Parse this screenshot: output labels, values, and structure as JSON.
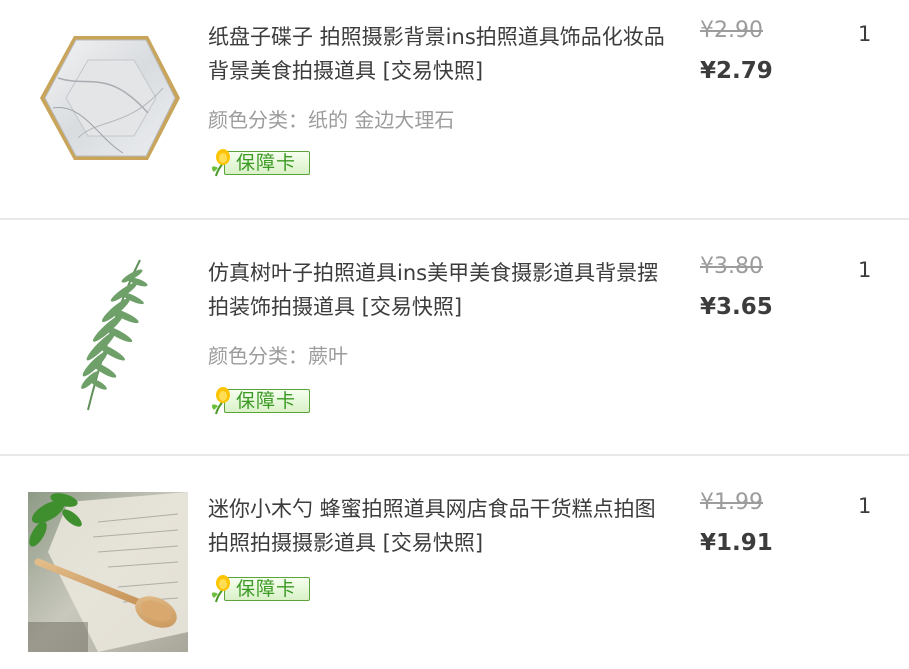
{
  "items": [
    {
      "title": "纸盘子碟子 拍照摄影背景ins拍照道具饰品化妆品背景美食拍摄道具 [交易快照]",
      "sku_label": "颜色分类：",
      "sku_value": "纸的 金边大理石",
      "badge": "保障卡",
      "price_original": "¥2.90",
      "price_current": "¥2.79",
      "quantity": "1",
      "thumb_icon": "hexagon-marble-plate"
    },
    {
      "title": "仿真树叶子拍照道具ins美甲美食摄影道具背景摆拍装饰拍摄道具 [交易快照]",
      "sku_label": "颜色分类：",
      "sku_value": "蕨叶",
      "badge": "保障卡",
      "price_original": "¥3.80",
      "price_current": "¥3.65",
      "quantity": "1",
      "thumb_icon": "fern-leaf"
    },
    {
      "title": "迷你小木勺 蜂蜜拍照道具网店食品干货糕点拍图拍照拍摄摄影道具 [交易快照]",
      "badge": "保障卡",
      "price_original": "¥1.99",
      "price_current": "¥1.91",
      "quantity": "1",
      "thumb_icon": "wooden-spoon-photo"
    }
  ],
  "colors": {
    "text": "#3c3c3c",
    "muted": "#9c9c9c",
    "badge_green": "#3b9a24",
    "divider": "#e8e8e8"
  }
}
